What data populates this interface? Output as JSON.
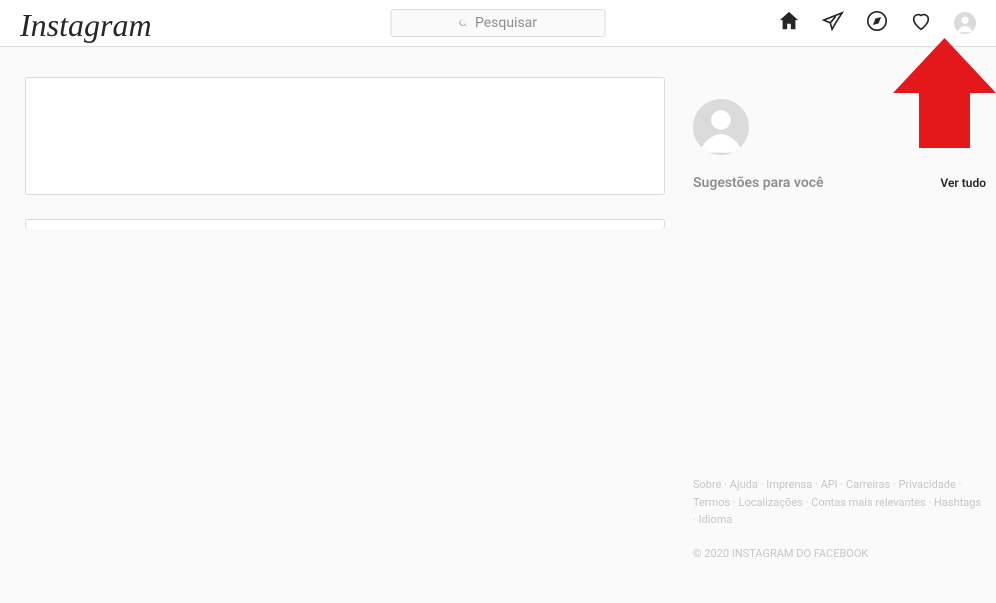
{
  "logo": "Instagram",
  "search": {
    "placeholder": "Pesquisar"
  },
  "sidebar": {
    "suggestions_title": "Sugestões para você",
    "see_all": "Ver tudo"
  },
  "footer": {
    "links": [
      "Sobre",
      "Ajuda",
      "Imprensa",
      "API",
      "Carreiras",
      "Privacidade",
      "Termos",
      "Localizações",
      "Contas mais relevantes",
      "Hashtags",
      "Idioma"
    ],
    "copyright": "© 2020 INSTAGRAM DO FACEBOOK"
  }
}
